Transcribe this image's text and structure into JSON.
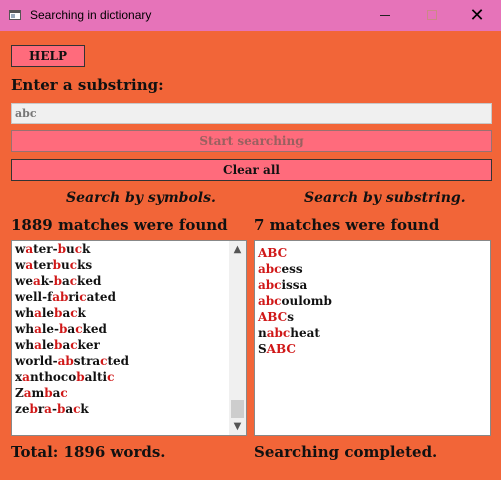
{
  "window": {
    "title": "Searching in dictionary",
    "icon": "window-app-icon"
  },
  "toolbar": {
    "help_label": "HELP"
  },
  "search": {
    "prompt": "Enter a substring:",
    "value": "abc",
    "start_label": "Start searching",
    "clear_label": "Clear all"
  },
  "left": {
    "heading": "Search by symbols.",
    "count_text": "1889 matches were found",
    "items": [
      [
        [
          "w",
          0
        ],
        [
          "a",
          1
        ],
        [
          "ter-",
          0
        ],
        [
          "b",
          1
        ],
        [
          "u",
          0
        ],
        [
          "c",
          1
        ],
        [
          "k",
          0
        ]
      ],
      [
        [
          "w",
          0
        ],
        [
          "a",
          1
        ],
        [
          "ter",
          0
        ],
        [
          "b",
          1
        ],
        [
          "u",
          0
        ],
        [
          "c",
          1
        ],
        [
          "ks",
          0
        ]
      ],
      [
        [
          "we",
          0
        ],
        [
          "a",
          1
        ],
        [
          "k-",
          0
        ],
        [
          "b",
          1
        ],
        [
          "a",
          0
        ],
        [
          "c",
          1
        ],
        [
          "ked",
          0
        ]
      ],
      [
        [
          "well-f",
          0
        ],
        [
          "a",
          1
        ],
        [
          "",
          0
        ],
        [
          "b",
          1
        ],
        [
          "ri",
          0
        ],
        [
          "c",
          1
        ],
        [
          "ated",
          0
        ]
      ],
      [
        [
          "wh",
          0
        ],
        [
          "a",
          1
        ],
        [
          "le",
          0
        ],
        [
          "b",
          1
        ],
        [
          "a",
          0
        ],
        [
          "c",
          1
        ],
        [
          "k",
          0
        ]
      ],
      [
        [
          "wh",
          0
        ],
        [
          "a",
          1
        ],
        [
          "le-",
          0
        ],
        [
          "b",
          1
        ],
        [
          "a",
          0
        ],
        [
          "c",
          1
        ],
        [
          "ked",
          0
        ]
      ],
      [
        [
          "wh",
          0
        ],
        [
          "a",
          1
        ],
        [
          "le",
          0
        ],
        [
          "b",
          1
        ],
        [
          "a",
          0
        ],
        [
          "c",
          1
        ],
        [
          "ker",
          0
        ]
      ],
      [
        [
          "world-",
          0
        ],
        [
          "a",
          1
        ],
        [
          "",
          0
        ],
        [
          "b",
          1
        ],
        [
          "stra",
          0
        ],
        [
          "c",
          1
        ],
        [
          "ted",
          0
        ]
      ],
      [
        [
          "x",
          0
        ],
        [
          "a",
          1
        ],
        [
          "nthoco",
          0
        ],
        [
          "b",
          1
        ],
        [
          "alti",
          0
        ],
        [
          "c",
          1
        ],
        [
          "",
          0
        ]
      ],
      [
        [
          "Z",
          0
        ],
        [
          "a",
          1
        ],
        [
          "m",
          0
        ],
        [
          "b",
          1
        ],
        [
          "a",
          0
        ],
        [
          "c",
          1
        ],
        [
          "",
          0
        ]
      ],
      [
        [
          "ze",
          0
        ],
        [
          "b",
          1
        ],
        [
          "r",
          0
        ],
        [
          "a",
          1
        ],
        [
          "-",
          0
        ],
        [
          "b",
          1
        ],
        [
          "a",
          0
        ],
        [
          "c",
          1
        ],
        [
          "k",
          0
        ]
      ]
    ],
    "status": "Total: 1896 words."
  },
  "right": {
    "heading": "Search by substring.",
    "count_text": "7 matches were found",
    "items": [
      [
        [
          "ABC",
          1
        ]
      ],
      [
        [
          "abc",
          1
        ],
        [
          "ess",
          0
        ]
      ],
      [
        [
          "abc",
          1
        ],
        [
          "issa",
          0
        ]
      ],
      [
        [
          "abc",
          1
        ],
        [
          "oulomb",
          0
        ]
      ],
      [
        [
          "ABC",
          1
        ],
        [
          "s",
          0
        ]
      ],
      [
        [
          "n",
          0
        ],
        [
          "abc",
          1
        ],
        [
          "heat",
          0
        ]
      ],
      [
        [
          "S",
          0
        ],
        [
          "ABC",
          1
        ]
      ]
    ],
    "status": "Searching completed."
  },
  "colors": {
    "background": "#f26538",
    "titlebar": "#e673b9",
    "button": "#ff6b7c",
    "highlight": "#d01818"
  }
}
